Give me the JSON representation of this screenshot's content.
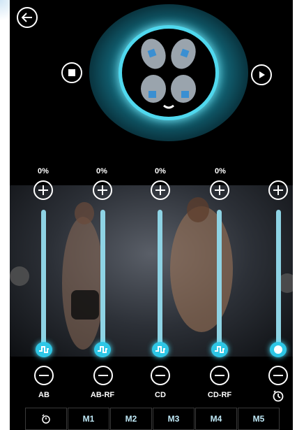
{
  "top": {
    "back": "arrow-left-icon",
    "stop": "stop-icon",
    "play": "play-icon"
  },
  "channels": [
    {
      "id": "ab",
      "percent": "0%",
      "label": "AB"
    },
    {
      "id": "ab-rf",
      "percent": "0%",
      "label": "AB-RF"
    },
    {
      "id": "cd",
      "percent": "0%",
      "label": "CD"
    },
    {
      "id": "cd-rf",
      "percent": "0%",
      "label": "CD-RF"
    },
    {
      "id": "timer",
      "percent": "",
      "label": ""
    }
  ],
  "bottom": {
    "modes": [
      "M1",
      "M2",
      "M3",
      "M4",
      "M5"
    ]
  },
  "colors": {
    "accent": "#2ec7e6",
    "track": "#8ed3e4",
    "background": "#000000"
  }
}
